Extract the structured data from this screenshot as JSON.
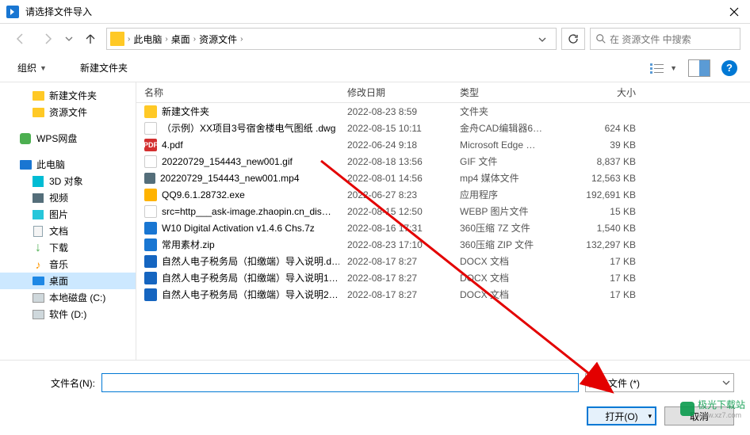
{
  "title": "请选择文件导入",
  "breadcrumb": {
    "parts": [
      "此电脑",
      "桌面",
      "资源文件"
    ]
  },
  "search": {
    "placeholder": "在 资源文件 中搜索"
  },
  "toolbar": {
    "organize": "组织",
    "newfolder": "新建文件夹"
  },
  "sidebar": {
    "items": [
      {
        "label": "新建文件夹",
        "icon": "folder",
        "indent": 2
      },
      {
        "label": "资源文件",
        "icon": "folder",
        "indent": 2
      },
      {
        "label": "WPS网盘",
        "icon": "green",
        "indent": 1,
        "gapBefore": true
      },
      {
        "label": "此电脑",
        "icon": "monitor",
        "indent": 1,
        "gapBefore": true
      },
      {
        "label": "3D 对象",
        "icon": "3d",
        "indent": 2
      },
      {
        "label": "视频",
        "icon": "video",
        "indent": 2
      },
      {
        "label": "图片",
        "icon": "pic",
        "indent": 2
      },
      {
        "label": "文档",
        "icon": "doc",
        "indent": 2
      },
      {
        "label": "下载",
        "icon": "down",
        "indent": 2
      },
      {
        "label": "音乐",
        "icon": "music",
        "indent": 2
      },
      {
        "label": "桌面",
        "icon": "desk",
        "indent": 2,
        "selected": true
      },
      {
        "label": "本地磁盘 (C:)",
        "icon": "disk",
        "indent": 2
      },
      {
        "label": "软件 (D:)",
        "icon": "disk",
        "indent": 2
      }
    ]
  },
  "columns": {
    "name": "名称",
    "date": "修改日期",
    "type": "类型",
    "size": "大小"
  },
  "files": [
    {
      "icon": "folder",
      "name": "新建文件夹",
      "date": "2022-08-23 8:59",
      "type": "文件夹",
      "size": ""
    },
    {
      "icon": "dwg",
      "name": "（示例）XX项目3号宿舍楼电气图纸 .dwg",
      "date": "2022-08-15 10:11",
      "type": "金舟CAD编辑器6…",
      "size": "624 KB"
    },
    {
      "icon": "pdf",
      "name": "4.pdf",
      "date": "2022-06-24 9:18",
      "type": "Microsoft Edge …",
      "size": "39 KB"
    },
    {
      "icon": "gif",
      "name": "20220729_154443_new001.gif",
      "date": "2022-08-18 13:56",
      "type": "GIF 文件",
      "size": "8,837 KB"
    },
    {
      "icon": "mp4",
      "name": "20220729_154443_new001.mp4",
      "date": "2022-08-01 14:56",
      "type": "mp4 媒体文件",
      "size": "12,563 KB"
    },
    {
      "icon": "exe",
      "name": "QQ9.6.1.28732.exe",
      "date": "2022-06-27 8:23",
      "type": "应用程序",
      "size": "192,691 KB"
    },
    {
      "icon": "webp",
      "name": "src=http___ask-image.zhaopin.cn_dis…",
      "date": "2022-08-15 12:50",
      "type": "WEBP 图片文件",
      "size": "15 KB"
    },
    {
      "icon": "7z",
      "name": "W10 Digital Activation v1.4.6 Chs.7z",
      "date": "2022-08-16 17:31",
      "type": "360压缩 7Z 文件",
      "size": "1,540 KB"
    },
    {
      "icon": "zip",
      "name": "常用素材.zip",
      "date": "2022-08-23 17:10",
      "type": "360压缩 ZIP 文件",
      "size": "132,297 KB"
    },
    {
      "icon": "docx",
      "name": "自然人电子税务局（扣缴端）导入说明.d…",
      "date": "2022-08-17 8:27",
      "type": "DOCX 文档",
      "size": "17 KB"
    },
    {
      "icon": "docx",
      "name": "自然人电子税务局（扣缴端）导入说明1…",
      "date": "2022-08-17 8:27",
      "type": "DOCX 文档",
      "size": "17 KB"
    },
    {
      "icon": "docx",
      "name": "自然人电子税务局（扣缴端）导入说明2…",
      "date": "2022-08-17 8:27",
      "type": "DOCX 文档",
      "size": "17 KB"
    }
  ],
  "bottom": {
    "filenameLabel": "文件名(N):",
    "filenameValue": "",
    "filter": "所有文件 (*)",
    "open": "打开(O)",
    "cancel": "取消"
  },
  "watermark": {
    "text": "极光下载站",
    "url": "www.xz7.com"
  }
}
